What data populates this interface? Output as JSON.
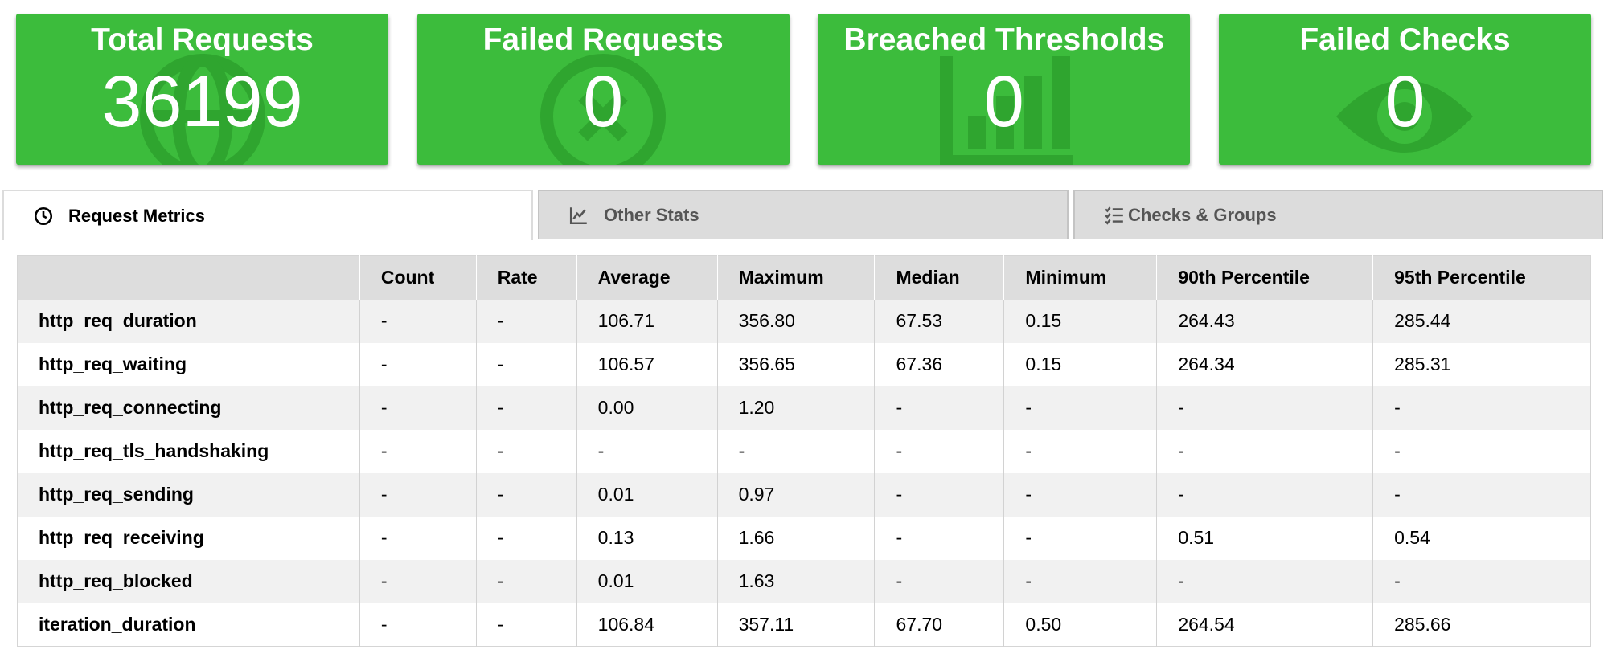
{
  "cards": [
    {
      "title": "Total Requests",
      "value": "36199",
      "icon": "globe-icon"
    },
    {
      "title": "Failed Requests",
      "value": "0",
      "icon": "x-circle-icon"
    },
    {
      "title": "Breached Thresholds",
      "value": "0",
      "icon": "bar-chart-icon"
    },
    {
      "title": "Failed Checks",
      "value": "0",
      "icon": "eye-icon"
    }
  ],
  "tabs": [
    {
      "label": "Request Metrics",
      "icon": "clock-icon",
      "active": true
    },
    {
      "label": "Other Stats",
      "icon": "line-chart-icon",
      "active": false
    },
    {
      "label": "Checks & Groups",
      "icon": "checklist-icon",
      "active": false
    }
  ],
  "table": {
    "headers": [
      "",
      "Count",
      "Rate",
      "Average",
      "Maximum",
      "Median",
      "Minimum",
      "90th Percentile",
      "95th Percentile"
    ],
    "rows": [
      [
        "http_req_duration",
        "-",
        "-",
        "106.71",
        "356.80",
        "67.53",
        "0.15",
        "264.43",
        "285.44"
      ],
      [
        "http_req_waiting",
        "-",
        "-",
        "106.57",
        "356.65",
        "67.36",
        "0.15",
        "264.34",
        "285.31"
      ],
      [
        "http_req_connecting",
        "-",
        "-",
        "0.00",
        "1.20",
        "-",
        "-",
        "-",
        "-"
      ],
      [
        "http_req_tls_handshaking",
        "-",
        "-",
        "-",
        "-",
        "-",
        "-",
        "-",
        "-"
      ],
      [
        "http_req_sending",
        "-",
        "-",
        "0.01",
        "0.97",
        "-",
        "-",
        "-",
        "-"
      ],
      [
        "http_req_receiving",
        "-",
        "-",
        "0.13",
        "1.66",
        "-",
        "-",
        "0.51",
        "0.54"
      ],
      [
        "http_req_blocked",
        "-",
        "-",
        "0.01",
        "1.63",
        "-",
        "-",
        "-",
        "-"
      ],
      [
        "iteration_duration",
        "-",
        "-",
        "106.84",
        "357.11",
        "67.70",
        "0.50",
        "264.54",
        "285.66"
      ]
    ]
  },
  "colors": {
    "card_green": "#3cbc3c",
    "card_icon_green": "#2fa52f",
    "header_gray": "#dddddd",
    "stripe_gray": "#f1f1f1"
  }
}
